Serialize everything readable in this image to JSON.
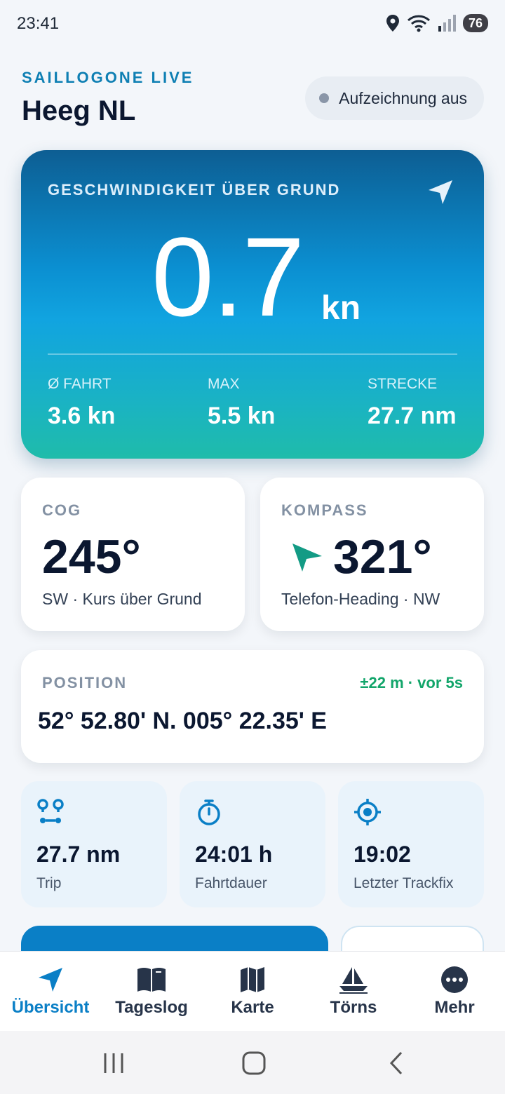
{
  "status_bar": {
    "time": "23:41",
    "battery": "76"
  },
  "header": {
    "brand": "SAILLOGONE LIVE",
    "location": "Heeg NL",
    "recording_status": "Aufzeichnung aus"
  },
  "speed": {
    "label": "GESCHWINDIGKEIT ÜBER GRUND",
    "value": "0.7",
    "unit": "kn",
    "stats": [
      {
        "label": "Ø FAHRT",
        "value": "3.6 kn"
      },
      {
        "label": "MAX",
        "value": "5.5 kn"
      },
      {
        "label": "STRECKE",
        "value": "27.7 nm"
      }
    ]
  },
  "cog": {
    "label": "COG",
    "value": "245°",
    "sub": "SW · Kurs über Grund"
  },
  "compass": {
    "label": "KOMPASS",
    "value": "321°",
    "sub": "Telefon-Heading · NW",
    "arrow_color": "#139b85"
  },
  "position": {
    "label": "POSITION",
    "meta": "±22 m · vor 5s",
    "value": "52° 52.80' N. 005° 22.35' E"
  },
  "tiles": [
    {
      "icon": "route-icon",
      "value": "27.7 nm",
      "label": "Trip"
    },
    {
      "icon": "stopwatch-icon",
      "value": "24:01 h",
      "label": "Fahrtdauer"
    },
    {
      "icon": "crosshair-icon",
      "value": "19:02",
      "label": "Letzter Trackfix"
    }
  ],
  "tabs": [
    {
      "label": "Übersicht",
      "icon": "navigation-icon",
      "active": true
    },
    {
      "label": "Tageslog",
      "icon": "book-icon"
    },
    {
      "label": "Karte",
      "icon": "map-icon"
    },
    {
      "label": "Törns",
      "icon": "sailboat-icon"
    },
    {
      "label": "Mehr",
      "icon": "more-icon"
    }
  ],
  "colors": {
    "accent": "#0a7fc6",
    "brand": "#0e7fb3",
    "ok": "#12a56a"
  }
}
